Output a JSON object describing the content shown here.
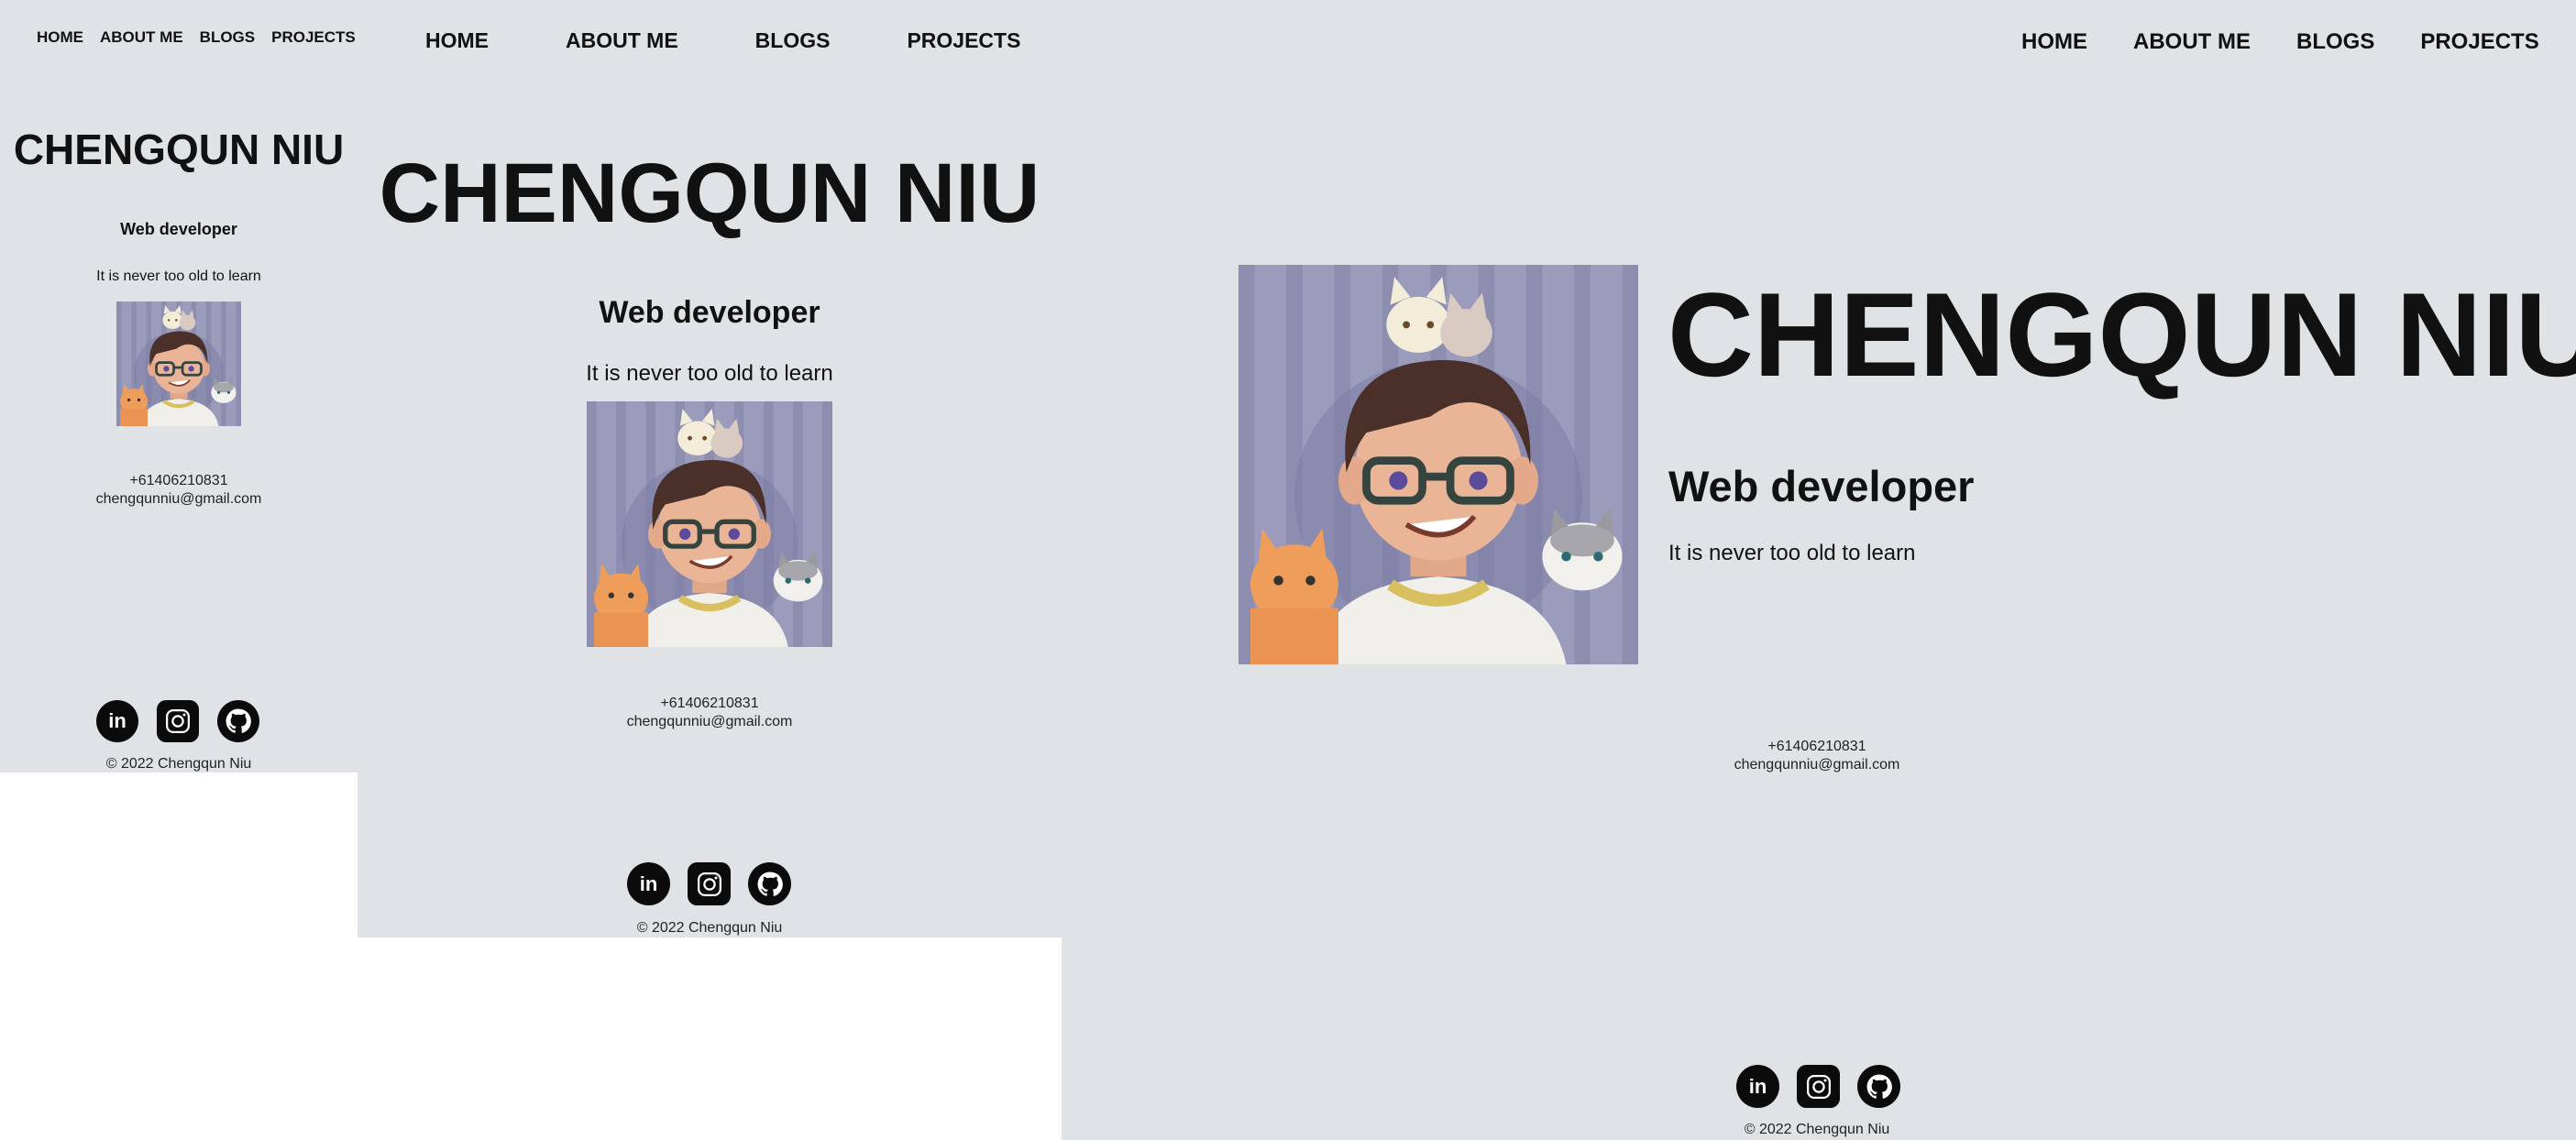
{
  "nav": {
    "home": "HOME",
    "about": "ABOUT ME",
    "blogs": "BLOGS",
    "projects": "PROJECTS"
  },
  "profile": {
    "name": "CHENGQUN NIU",
    "role": "Web developer",
    "tagline": "It is never too old to learn"
  },
  "contact": {
    "phone": "+61406210831",
    "email": "chengqunniu@gmail.com"
  },
  "footer": {
    "copyright": "© 2022 Chengqun Niu"
  },
  "social": [
    {
      "label": "in",
      "icon": "linkedin-icon"
    },
    {
      "icon": "instagram-icon"
    },
    {
      "icon": "github-icon"
    }
  ],
  "colors": {
    "background": "#e0e3e5",
    "avatar_bg": "#9a9ab8",
    "text": "#111111"
  }
}
